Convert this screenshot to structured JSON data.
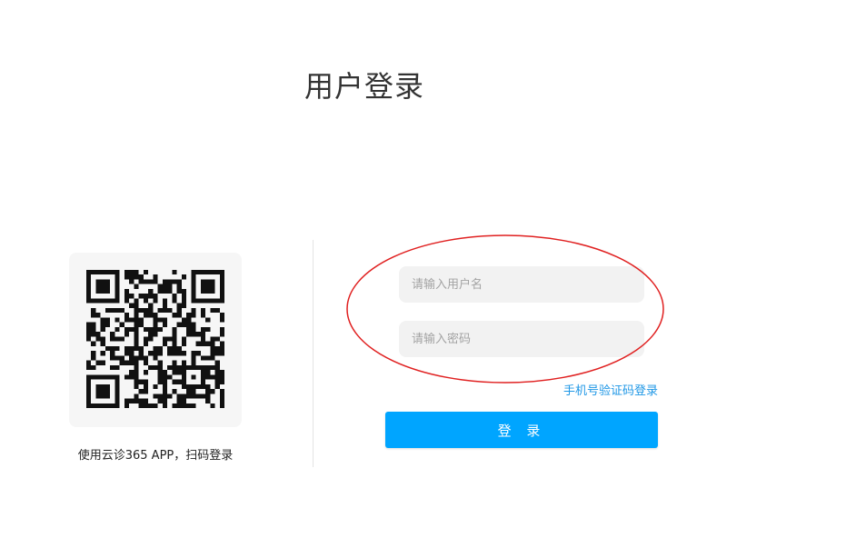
{
  "header": {
    "title": "用户登录"
  },
  "qr": {
    "caption": "使用云诊365 APP，扫码登录"
  },
  "form": {
    "username_placeholder": "请输入用户名",
    "password_placeholder": "请输入密码",
    "sms_login_link": "手机号验证码登录",
    "login_button": "登 录"
  },
  "colors": {
    "accent": "#00a5ff",
    "link": "#1f97e6",
    "annotation": "#e02020",
    "field_bg": "#f2f2f2"
  }
}
